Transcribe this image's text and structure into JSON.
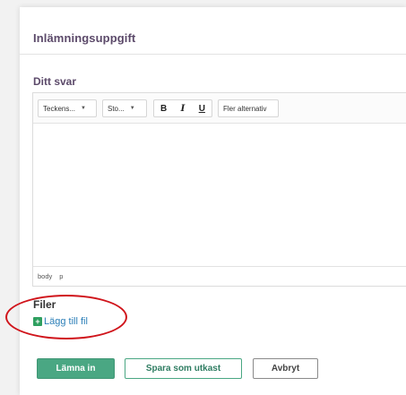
{
  "card": {
    "title": "Inlämningsuppgift"
  },
  "answer": {
    "label": "Ditt svar"
  },
  "editor": {
    "font_select": "Teckens...",
    "size_select": "Sto...",
    "bold": "B",
    "italic": "I",
    "underline": "U",
    "more_options": "Fler alternativ",
    "status_path": [
      "body",
      "p"
    ]
  },
  "files": {
    "label": "Filer",
    "add_file": "Lägg till fil"
  },
  "actions": {
    "submit": "Lämna in",
    "save_draft": "Spara som utkast",
    "cancel": "Avbryt"
  },
  "colors": {
    "accent_green": "#4aa783",
    "title_purple": "#5c4a6a",
    "link_blue": "#2c7fb8",
    "highlight_red": "#d0141b"
  }
}
